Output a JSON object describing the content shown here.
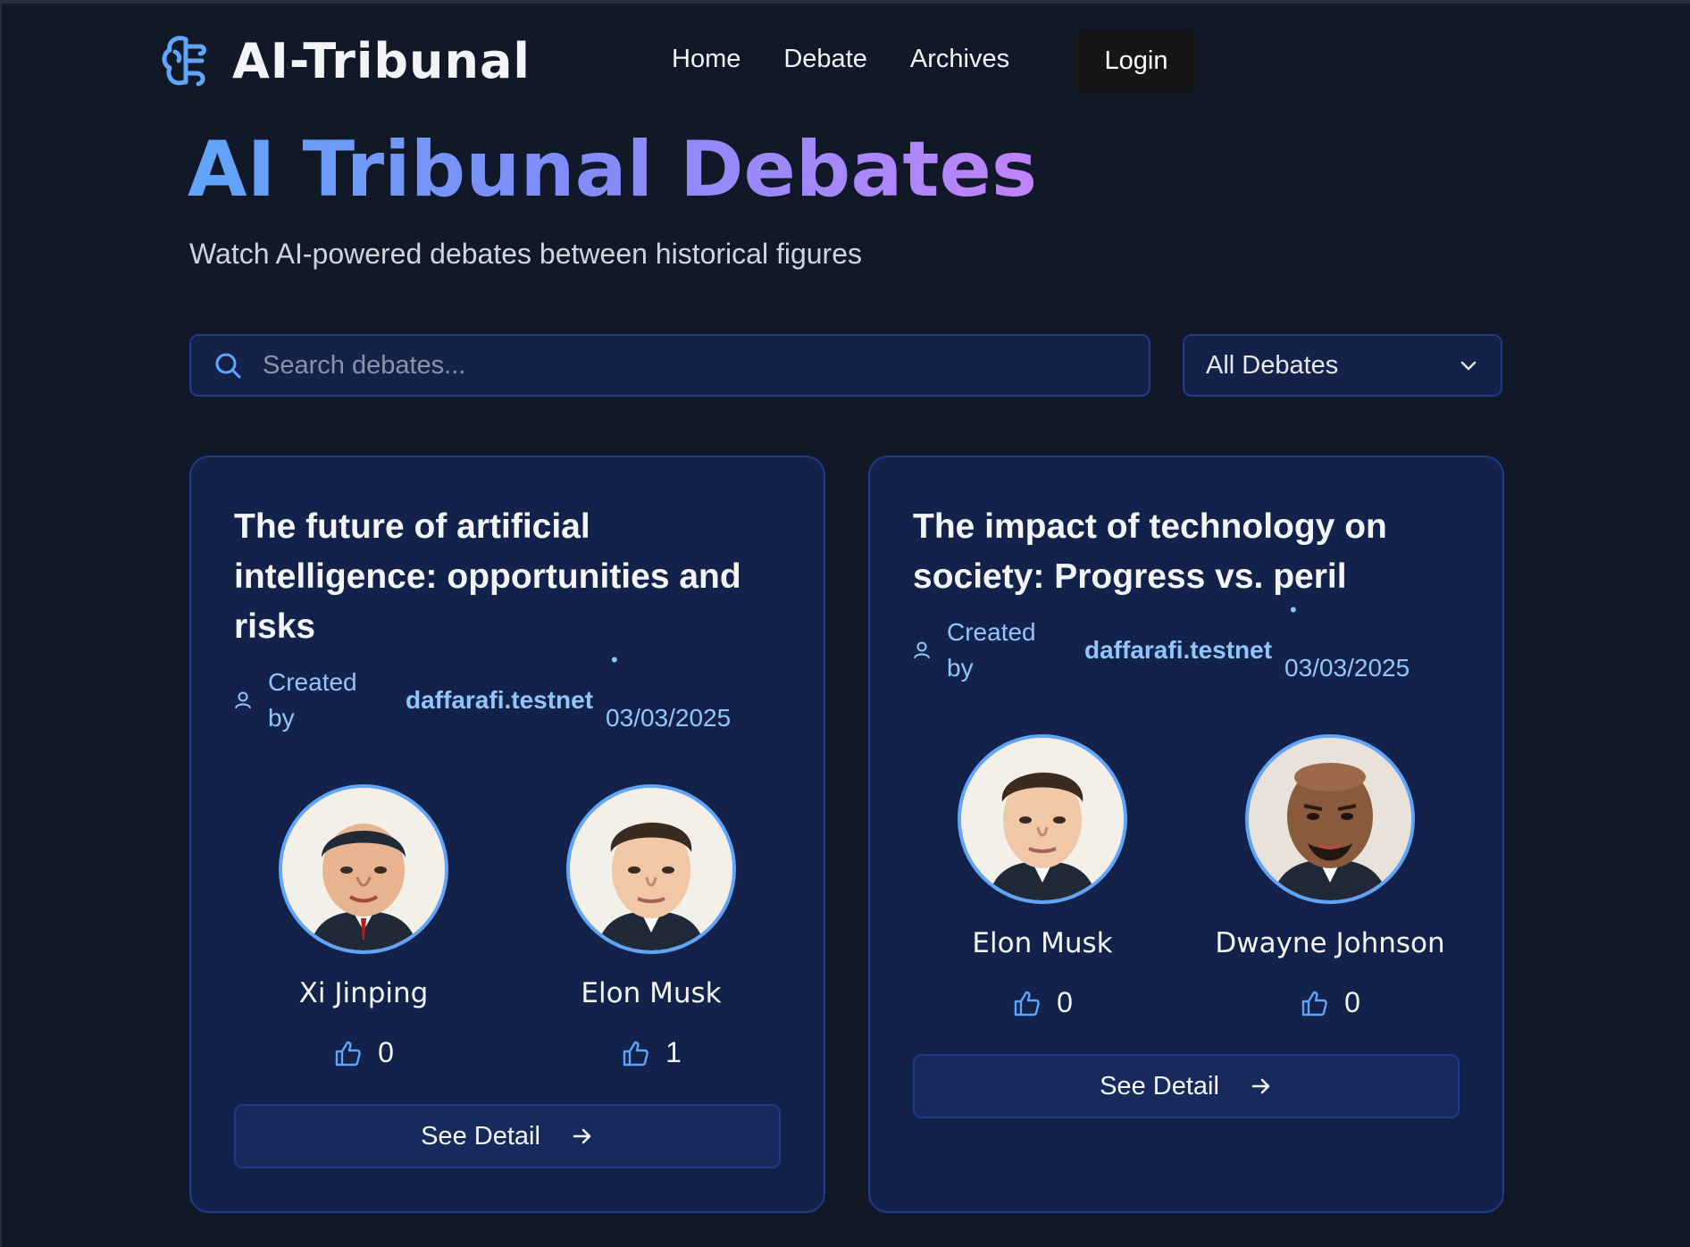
{
  "brand": {
    "name": "AI-Tribunal",
    "accent": "#60a5fa"
  },
  "nav": {
    "items": [
      "Home",
      "Debate",
      "Archives"
    ],
    "login_label": "Login"
  },
  "hero": {
    "title_part1": "AI Tribunal ",
    "title_part2": "Debates",
    "subtitle": "Watch AI-powered debates between historical figures"
  },
  "search": {
    "placeholder": "Search debates...",
    "value": ""
  },
  "filter": {
    "selected": "All Debates"
  },
  "debates": [
    {
      "title": "The future of artificial intelligence: opportunities and risks",
      "created_label": "Created by",
      "creator": "daffarafi.testnet",
      "separator": "•",
      "date": "03/03/2025",
      "participants": [
        {
          "name": "Xi Jinping",
          "likes": "0"
        },
        {
          "name": "Elon Musk",
          "likes": "1"
        }
      ],
      "button_label": "See Detail"
    },
    {
      "title": "The impact of technology on society: Progress vs. peril",
      "created_label": "Created by",
      "creator": "daffarafi.testnet",
      "separator": "•",
      "date": "03/03/2025",
      "participants": [
        {
          "name": "Elon Musk",
          "likes": "0"
        },
        {
          "name": "Dwayne Johnson",
          "likes": "0"
        }
      ],
      "button_label": "See Detail"
    }
  ],
  "colors": {
    "background": "#111827",
    "card": "#13224a",
    "border": "#1e3a8a",
    "link": "#93c5fd"
  }
}
